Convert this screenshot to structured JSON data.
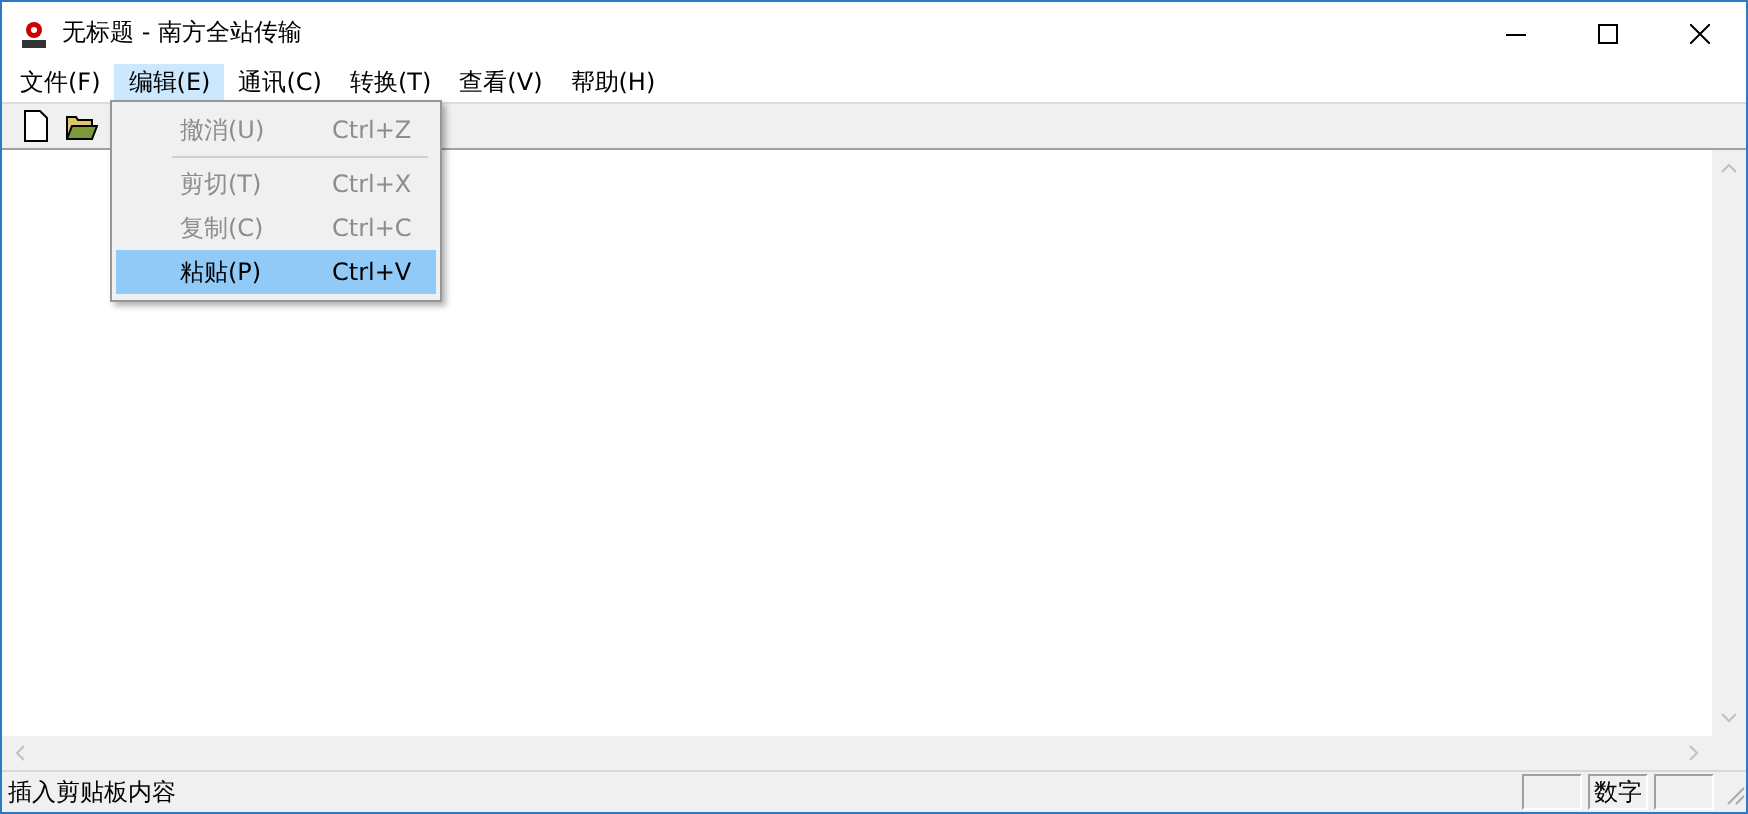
{
  "window": {
    "title": "无标题 - 南方全站传输"
  },
  "menu": [
    {
      "label": "文件(F)",
      "selected": false
    },
    {
      "label": "编辑(E)",
      "selected": true
    },
    {
      "label": "通讯(C)",
      "selected": false
    },
    {
      "label": "转换(T)",
      "selected": false
    },
    {
      "label": "查看(V)",
      "selected": false
    },
    {
      "label": "帮助(H)",
      "selected": false
    }
  ],
  "dropdown": [
    {
      "kind": "item",
      "label": "撤消(U)",
      "shortcut": "Ctrl+Z",
      "disabled": true,
      "selected": false
    },
    {
      "kind": "separator"
    },
    {
      "kind": "item",
      "label": "剪切(T)",
      "shortcut": "Ctrl+X",
      "disabled": true,
      "selected": false
    },
    {
      "kind": "item",
      "label": "复制(C)",
      "shortcut": "Ctrl+C",
      "disabled": true,
      "selected": false
    },
    {
      "kind": "item",
      "label": "粘贴(P)",
      "shortcut": "Ctrl+V",
      "disabled": false,
      "selected": true
    }
  ],
  "status_bar": {
    "message": "插入剪贴板内容",
    "panes": [
      {
        "kind": "empty"
      },
      {
        "kind": "text",
        "label": "数字"
      },
      {
        "kind": "empty"
      }
    ]
  }
}
